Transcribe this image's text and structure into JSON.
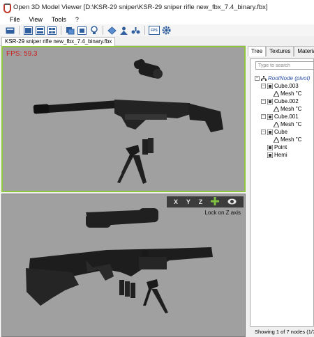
{
  "window": {
    "title": "Open 3D Model Viewer  [D:\\KSR-29 sniper\\KSR-29 sniper rifle new_fbx_7.4_binary.fbx]"
  },
  "menu": [
    "File",
    "View",
    "Tools",
    "?"
  ],
  "toolbar": {
    "fps_button_label": "FPS",
    "icons": [
      "open-icon",
      "layout-single-icon",
      "layout-split-icon",
      "layout-quad-icon",
      "reset-view-icon",
      "save-screenshot-icon",
      "bulb-icon",
      "scene-icon",
      "person-icon",
      "link-icon",
      "fps-icon",
      "settings-gear-icon"
    ]
  },
  "document_tab": "KSR-29 sniper rifle new_fbx_7.4_binary.fbx",
  "viewport_top": {
    "fps_text": "FPS: 59.3",
    "fps_color": "#cc1f1f",
    "active_border_color": "#8ec63f"
  },
  "viewport_bottom": {
    "axis_buttons": [
      "X",
      "Y",
      "Z"
    ],
    "axis_icons": [
      "plus-icon",
      "eye-icon"
    ],
    "lock_text": "Lock on Z axis"
  },
  "side_tabs": [
    "Tree",
    "Textures",
    "Materials"
  ],
  "tree": {
    "search_placeholder": "Type to search",
    "root": "RootNode (pivot)",
    "nodes": [
      {
        "label": "Cube.003",
        "child": "Mesh \"C"
      },
      {
        "label": "Cube.002",
        "child": "Mesh \"C"
      },
      {
        "label": "Cube.001",
        "child": "Mesh \"C"
      },
      {
        "label": "Cube",
        "child": "Mesh \"C"
      },
      {
        "label": "Point",
        "child": null
      },
      {
        "label": "Hemi",
        "child": null
      }
    ]
  },
  "statusbar": "Showing 1 of 7 nodes (1/7)"
}
